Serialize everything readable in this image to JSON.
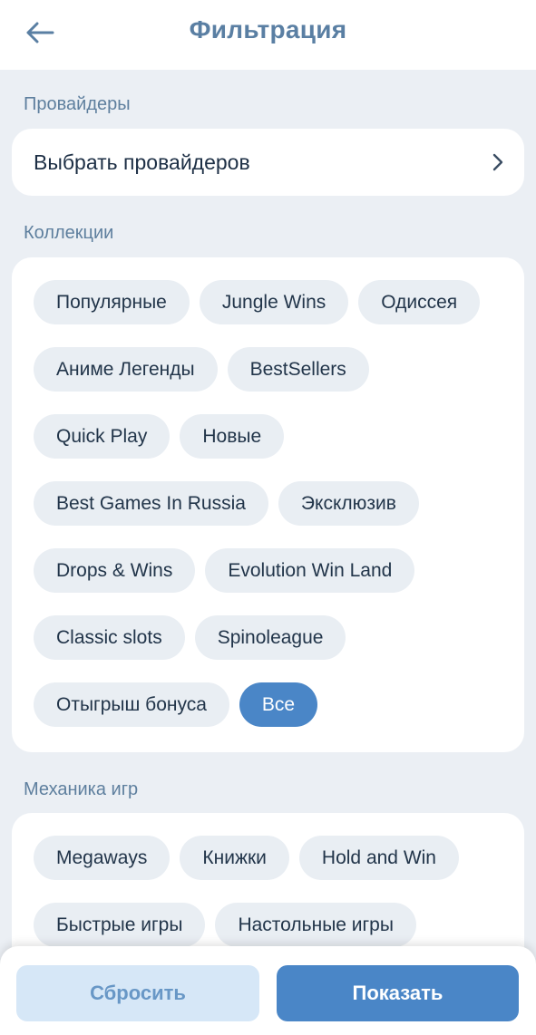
{
  "header": {
    "title": "Фильтрация"
  },
  "providers": {
    "label": "Провайдеры",
    "select_label": "Выбрать провайдеров"
  },
  "collections": {
    "label": "Коллекции",
    "chips": [
      "Популярные",
      "Jungle Wins",
      "Одиссея",
      "Аниме Легенды",
      "BestSellers",
      "Quick Play",
      "Новые",
      "Best Games In Russia",
      "Эксклюзив",
      "Drops & Wins",
      "Evolution Win Land",
      "Classic slots",
      "Spinoleague",
      "Отыгрыш бонуса",
      "Все"
    ],
    "active": "Все"
  },
  "mechanics": {
    "label": "Механика игр",
    "chips": [
      "Megaways",
      "Книжки",
      "Hold and Win",
      "Быстрые игры",
      "Настольные игры"
    ]
  },
  "footer": {
    "reset_label": "Сбросить",
    "show_label": "Показать"
  },
  "colors": {
    "accent": "#4a86c7",
    "background": "#ebeff4",
    "title": "#5a7fa3",
    "reset_bg": "#d6e7f7"
  }
}
